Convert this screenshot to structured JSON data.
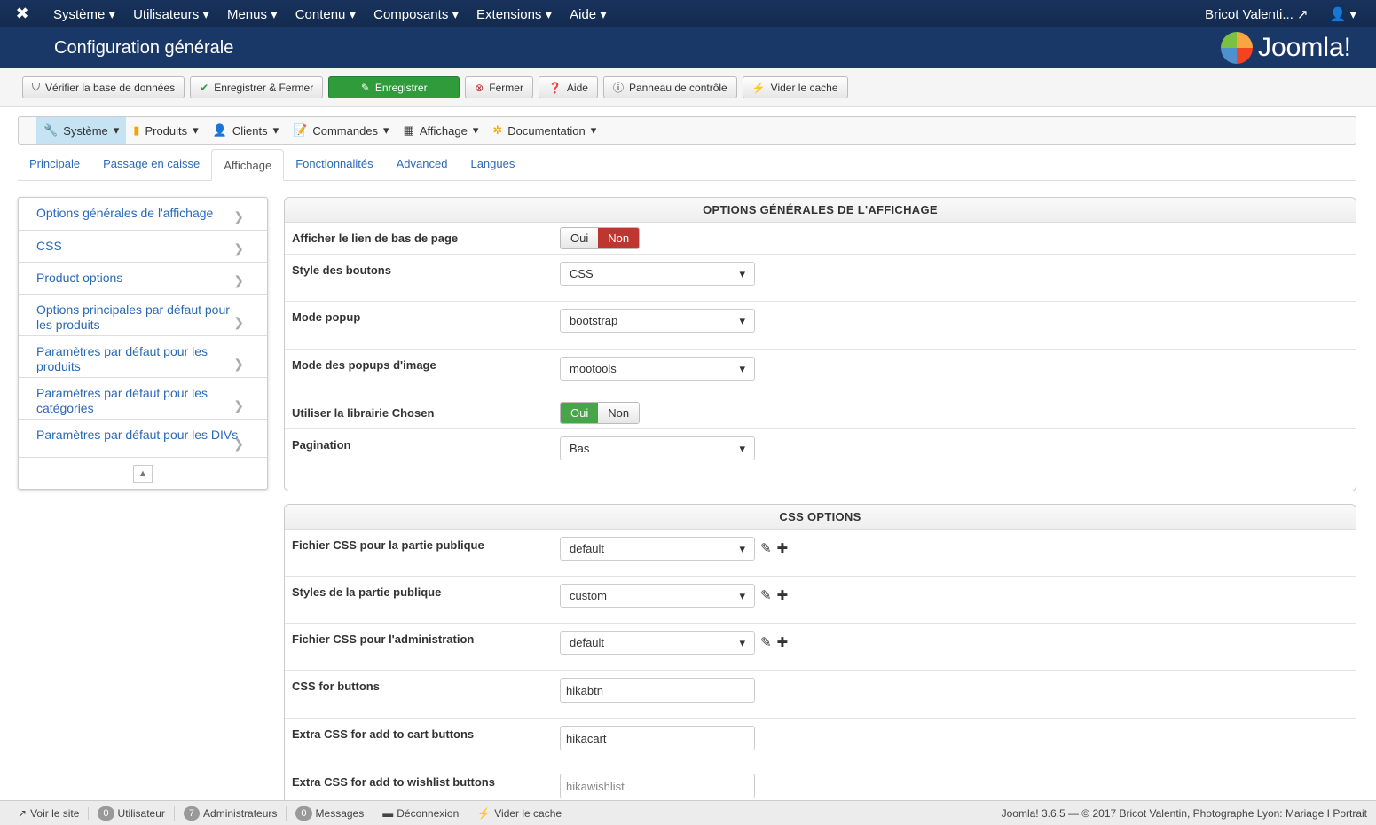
{
  "topnav": {
    "menus": [
      "Système",
      "Utilisateurs",
      "Menus",
      "Contenu",
      "Composants",
      "Extensions",
      "Aide"
    ],
    "user": "Bricot Valenti..."
  },
  "header": {
    "title": "Configuration générale",
    "brand": "Joomla!"
  },
  "toolbar": {
    "check_db": "Vérifier la base de données",
    "save_close": "Enregistrer & Fermer",
    "save": "Enregistrer",
    "close": "Fermer",
    "help": "Aide",
    "control_panel": "Panneau de contrôle",
    "clear_cache": "Vider le cache"
  },
  "hikanav": [
    {
      "label": "Système",
      "icon": "🔧"
    },
    {
      "label": "Produits",
      "icon": "▮"
    },
    {
      "label": "Clients",
      "icon": "👤"
    },
    {
      "label": "Commandes",
      "icon": "📝"
    },
    {
      "label": "Affichage",
      "icon": "▦"
    },
    {
      "label": "Documentation",
      "icon": "✲"
    }
  ],
  "tabs": [
    "Principale",
    "Passage en caisse",
    "Affichage",
    "Fonctionnalités",
    "Advanced",
    "Langues"
  ],
  "sidebar": [
    "Options générales de l'affichage",
    "CSS",
    "Product options",
    "Options principales par défaut pour les produits",
    "Paramètres par défaut pour les produits",
    "Paramètres par défaut pour les catégories",
    "Paramètres par défaut pour les DIVs"
  ],
  "general": {
    "title": "OPTIONS GÉNÉRALES DE L'AFFICHAGE",
    "footer_link": {
      "label": "Afficher le lien de bas de page",
      "yes": "Oui",
      "no": "Non"
    },
    "button_style": {
      "label": "Style des boutons",
      "value": "CSS"
    },
    "popup_mode": {
      "label": "Mode popup",
      "value": "bootstrap"
    },
    "image_popup": {
      "label": "Mode des popups d'image",
      "value": "mootools"
    },
    "chosen": {
      "label": "Utiliser la librairie Chosen",
      "yes": "Oui",
      "no": "Non"
    },
    "pagination": {
      "label": "Pagination",
      "value": "Bas"
    }
  },
  "css": {
    "title": "CSS OPTIONS",
    "front_css": {
      "label": "Fichier CSS pour la partie publique",
      "value": "default"
    },
    "front_styles": {
      "label": "Styles de la partie publique",
      "value": "custom"
    },
    "admin_css": {
      "label": "Fichier CSS pour l'administration",
      "value": "default"
    },
    "buttons": {
      "label": "CSS for buttons",
      "value": "hikabtn"
    },
    "cart": {
      "label": "Extra CSS for add to cart buttons",
      "value": "hikacart"
    },
    "wishlist": {
      "label": "Extra CSS for add to wishlist buttons",
      "value": "hikawishlist"
    }
  },
  "status": {
    "view_site": "Voir le site",
    "users_count": "0",
    "users": "Utilisateur",
    "admins_count": "7",
    "admins": "Administrateurs",
    "messages_count": "0",
    "messages": "Messages",
    "logout": "Déconnexion",
    "clear_cache": "Vider le cache",
    "copyright": "Joomla! 3.6.5 — © 2017 Bricot Valentin, Photographe Lyon: Mariage I Portrait"
  }
}
